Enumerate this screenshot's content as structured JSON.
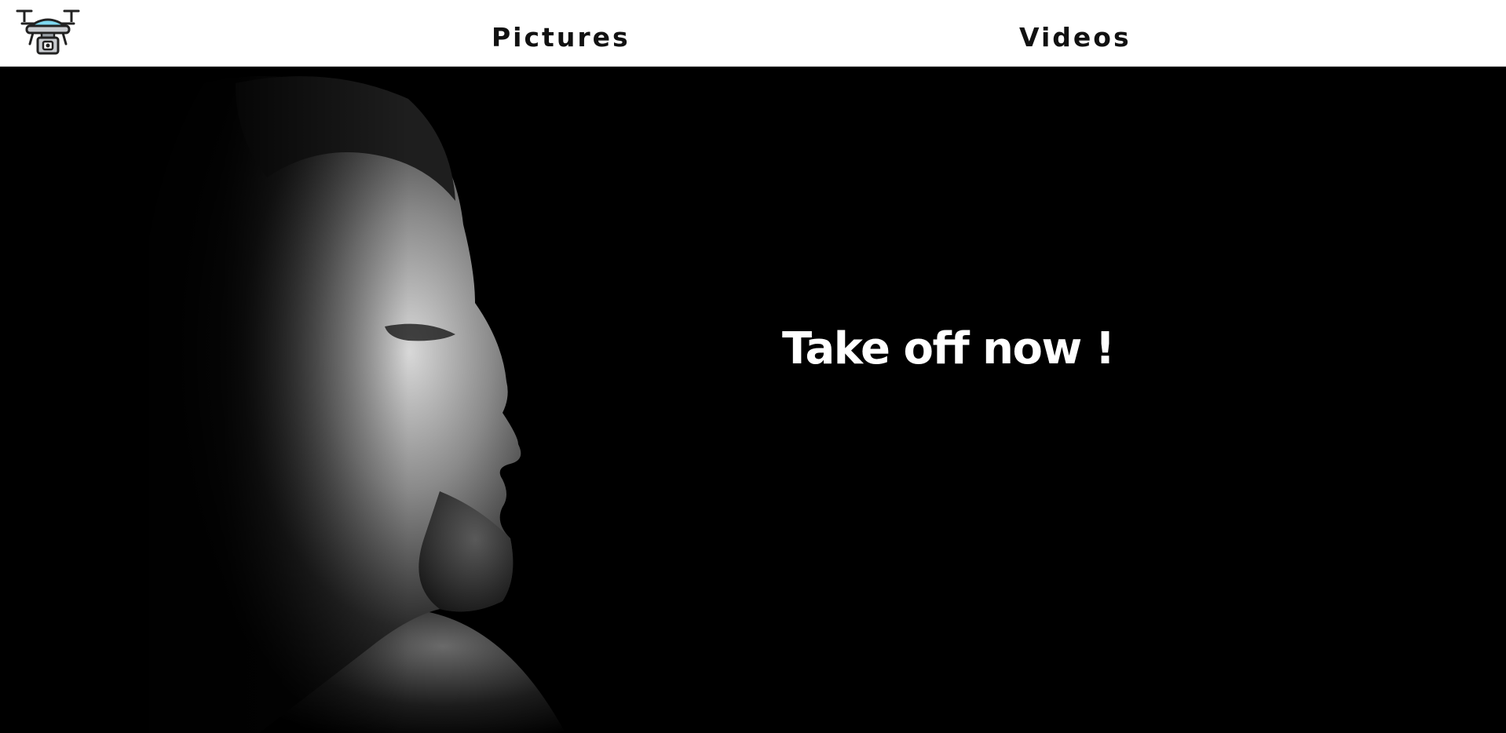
{
  "brand": {
    "logo_icon": "drone-icon",
    "accent_color": "#7ed8f0"
  },
  "nav": {
    "items": [
      {
        "label": "Pictures"
      },
      {
        "label": "Videos"
      }
    ]
  },
  "hero": {
    "title": "Take off now !",
    "background_image": "man-profile-portrait-photo",
    "background_color": "#000000",
    "text_color": "#ffffff"
  }
}
